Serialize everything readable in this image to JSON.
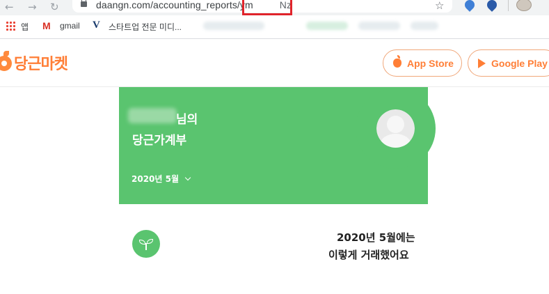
{
  "browser": {
    "url_host": "daangn.com",
    "url_path": "/accounting_reports/ym",
    "url_tail": "Nz",
    "bookmarks": [
      "앱",
      "gmail",
      "스타트업 전문 미디..."
    ]
  },
  "header": {
    "brand": "당근마켓",
    "app_store_label": "App Store",
    "google_play_label": "Google Play",
    "brand_color": "#ff7e36"
  },
  "card": {
    "title_suffix": "님의",
    "title_line2": "당근가계부",
    "month": "2020년 5월",
    "color": "#5ac46f"
  },
  "summary": {
    "line1": "2020년 5월에는",
    "line2": "이렇게 거래했어요"
  },
  "icons": [
    "back-icon",
    "forward-icon",
    "reload-icon",
    "lock-icon",
    "star-icon",
    "apps-icon",
    "gmail-icon",
    "apple-icon",
    "play-icon",
    "chevron-down-icon",
    "sprout-icon",
    "profile-icon"
  ]
}
